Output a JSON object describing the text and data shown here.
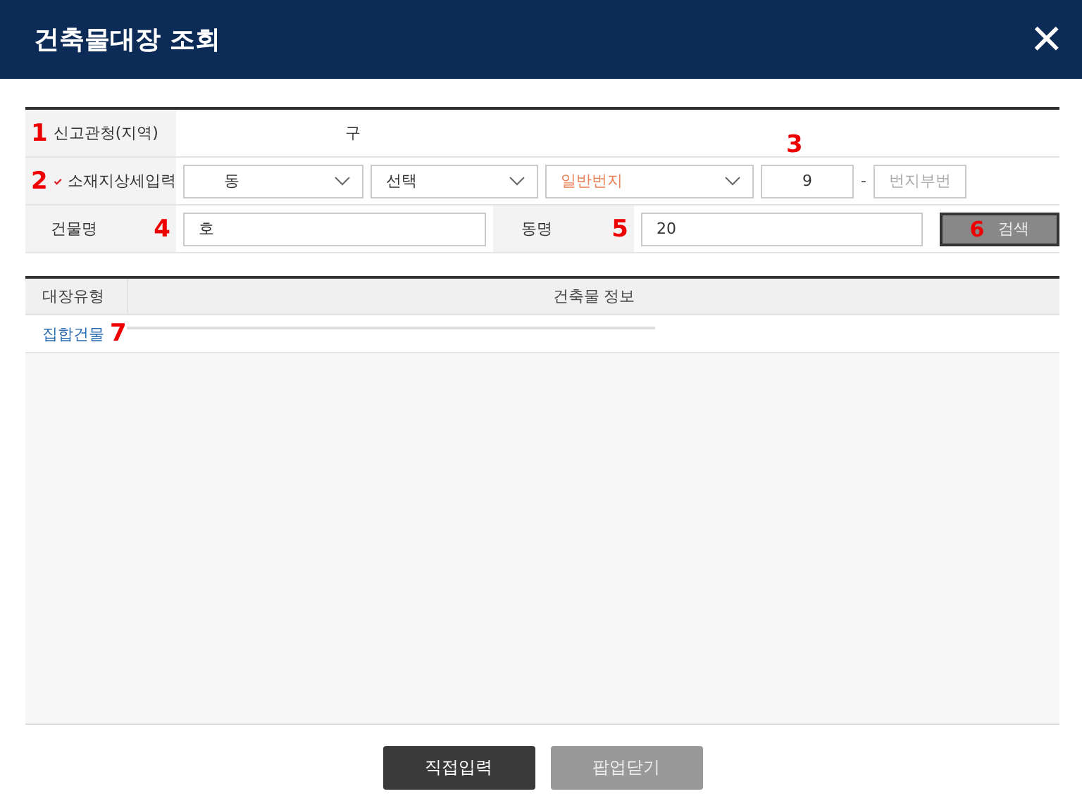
{
  "window": {
    "title": "건축물대장 조회",
    "close": "×"
  },
  "form": {
    "authority": {
      "marker": "1",
      "label": "신고관청(지역)",
      "value": "구"
    },
    "address": {
      "marker": "2",
      "label": "소재지상세입력",
      "checked": true,
      "dong": "동",
      "select": "선택",
      "lot_type": "일반번지",
      "marker_main": "3",
      "main_no": "9",
      "dash": "-",
      "sub_no_placeholder": "번지부번"
    },
    "building": {
      "label": "건물명",
      "marker": "4",
      "value": "호"
    },
    "dong_name": {
      "label": "동명",
      "marker": "5",
      "value": "20"
    },
    "search": {
      "marker": "6",
      "label": "검색"
    }
  },
  "table": {
    "columns": [
      "대장유형",
      "건축물 정보"
    ],
    "rows": [
      {
        "type": "집합건물",
        "marker": "7"
      }
    ]
  },
  "buttons": [
    {
      "label": "직접입력",
      "kind": "primary"
    },
    {
      "label": "팝업닫기",
      "kind": "secondary"
    }
  ]
}
